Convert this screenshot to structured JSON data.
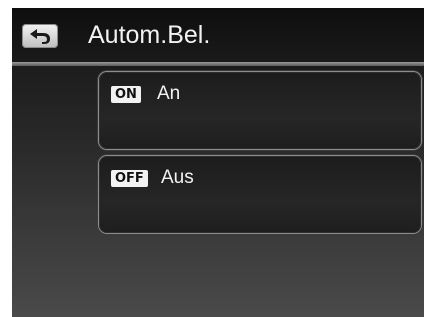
{
  "header": {
    "title": "Autom.Bel.",
    "back_icon": "back-arrow-icon"
  },
  "options": [
    {
      "badge": "ON",
      "label": "An"
    },
    {
      "badge": "OFF",
      "label": "Aus"
    }
  ],
  "colors": {
    "background": "#1d1d1d",
    "text": "#f2f2f2",
    "border": "#8c8c8c"
  }
}
